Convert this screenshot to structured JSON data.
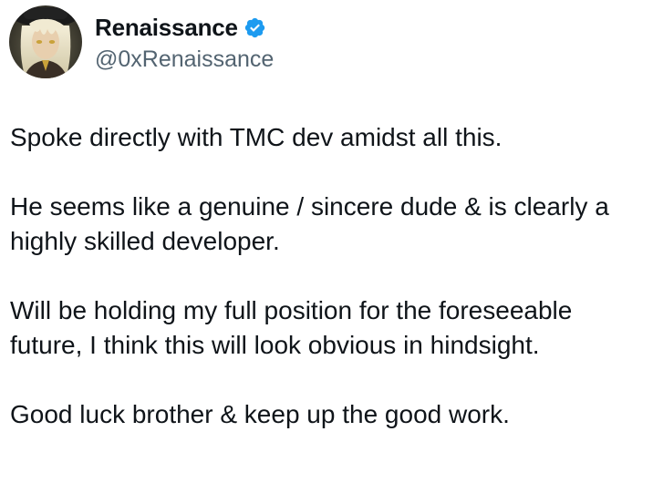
{
  "tweet": {
    "author": {
      "display_name": "Renaissance",
      "handle": "@0xRenaissance",
      "verified": true,
      "verified_badge_color": "#1d9bf0",
      "avatar_icon": "anime-character-avatar"
    },
    "paragraphs": [
      "Spoke directly with TMC dev amidst all this.",
      "He seems like a genuine / sincere dude & is clearly a highly skilled developer.",
      "Will be holding my full position for the foreseeable future, I think this will look obvious in hindsight.",
      "Good luck brother & keep up the good work."
    ]
  },
  "colors": {
    "text_primary": "#0f1419",
    "text_secondary": "#536471",
    "background": "#ffffff"
  }
}
